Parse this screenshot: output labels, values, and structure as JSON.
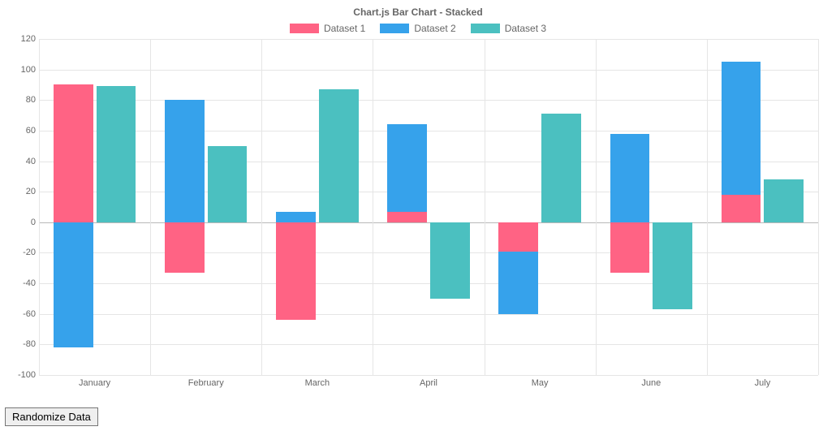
{
  "chart_data": {
    "type": "bar",
    "stacked": true,
    "title": "Chart.js Bar Chart - Stacked",
    "categories": [
      "January",
      "February",
      "March",
      "April",
      "May",
      "June",
      "July"
    ],
    "series": [
      {
        "name": "Dataset 1",
        "color": "#ff6384",
        "stack": 0,
        "values": [
          90,
          -33,
          -64,
          7,
          -19,
          -33,
          18
        ]
      },
      {
        "name": "Dataset 2",
        "color": "#36a2eb",
        "stack": 0,
        "values": [
          -82,
          80,
          7,
          57,
          -41,
          58,
          87
        ]
      },
      {
        "name": "Dataset 3",
        "color": "#4bc0c0",
        "stack": 1,
        "values": [
          89,
          50,
          87,
          -50,
          71,
          -57,
          28
        ]
      }
    ],
    "ylim": [
      -100,
      120
    ],
    "ystep": 20,
    "xlabel": "",
    "ylabel": ""
  },
  "button_label": "Randomize Data"
}
